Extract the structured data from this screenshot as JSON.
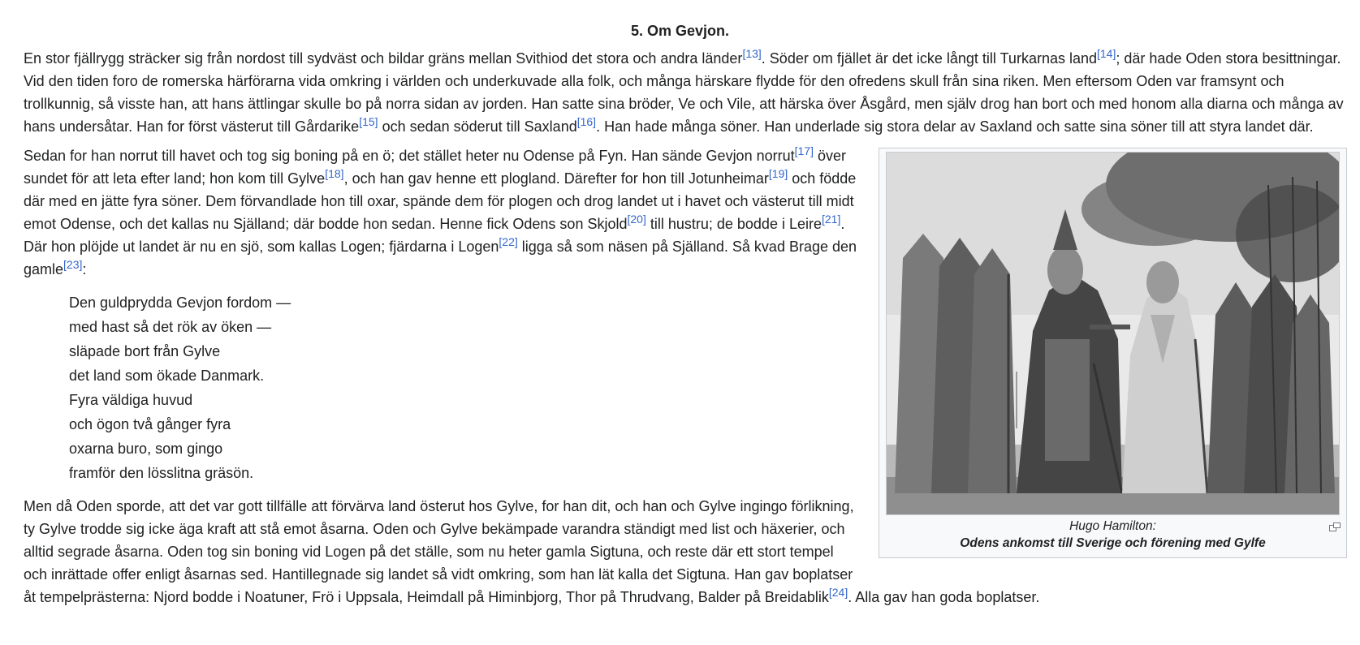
{
  "section": {
    "title": "5. Om Gevjon."
  },
  "paragraphs": {
    "p1": {
      "t1": "En stor fjällrygg sträcker sig från nordost till sydväst och bildar gräns mellan Svithiod det stora och andra länder",
      "r1": "[13]",
      "t2": ". Söder om fjället är det icke långt till Turkarnas land",
      "r2": "[14]",
      "t3": "; där hade Oden stora besittningar. Vid den tiden foro de romerska härförarna vida omkring i världen och underkuvade alla folk, och många härskare flydde för den ofredens skull från sina riken. Men eftersom Oden var framsynt och trollkunnig, så visste han, att hans ättlingar skulle bo på norra sidan av jorden. Han satte sina bröder, Ve och Vile, att härska över Åsgård, men själv drog han bort och med honom alla diarna och många av hans undersåtar. Han for först västerut till Gårdarike",
      "r3": "[15]",
      "t4": " och sedan söderut till Saxland",
      "r4": "[16]",
      "t5": ". Han hade många söner. Han underlade sig stora delar av Saxland och satte sina söner till att styra landet där."
    },
    "p2": {
      "t1": "Sedan for han norrut till havet och tog sig boning på en ö; det stället heter nu Odense på Fyn. Han sände Gevjon norrut",
      "r1": "[17]",
      "t2": " över sundet för att leta efter land; hon kom till Gylve",
      "r2": "[18]",
      "t3": ", och han gav henne ett plogland. Därefter for hon till Jotunheimar",
      "r3": "[19]",
      "t4": " och födde där med en jätte fyra söner. Dem förvandlade hon till oxar, spände dem för plogen och drog landet ut i havet och västerut till midt emot Odense, och det kallas nu Själland; där bodde hon sedan. Henne fick Odens son Skjold",
      "r4": "[20]",
      "t5": " till hustru; de bodde i Leire",
      "r5": "[21]",
      "t6": ". Där hon plöjde ut landet är nu en sjö, som kallas Logen; fjärdarna i Logen",
      "r6": "[22]",
      "t7": " ligga så som näsen på Själland. Så kvad Brage den gamle",
      "r7": "[23]",
      "t8": ":"
    },
    "poem": [
      "Den guldprydda Gevjon fordom —",
      "med hast så det rök av öken —",
      "släpade bort från Gylve",
      "det land som ökade Danmark.",
      "Fyra väldiga huvud",
      "och ögon två gånger fyra",
      "oxarna buro, som gingo",
      "framför den lösslitna gräsön."
    ],
    "p3": {
      "t1": "Men då Oden sporde, att det var gott tillfälle att förvärva land österut hos Gylve, for han dit, och han och Gylve ingingo förlikning, ty Gylve trodde sig icke äga kraft att stå emot åsarna. Oden och Gylve bekämpade varandra ständigt med list och häxerier, och alltid segrade åsarna. Oden tog sin boning vid Logen på det ställe, som nu heter gamla Sigtuna, och reste där ett stort tempel och inrättade offer enligt åsarnas sed. Hantillegnade sig landet så vidt omkring, som han lät kalla det Sigtuna. Han gav boplatser åt tempelprästerna: Njord bodde i Noatuner, Frö i Uppsala, Heimdall på Himinbjorg, Thor på Thrudvang, Balder på Breidablik",
      "r1": "[24]",
      "t2": ". Alla gav han goda boplatser."
    }
  },
  "figure": {
    "caption_author": "Hugo Hamilton:",
    "caption_title": "Odens ankomst till Sverige och förening med Gylfe",
    "enlarge_icon": "enlarge-icon",
    "link_color": "#3366cc"
  }
}
